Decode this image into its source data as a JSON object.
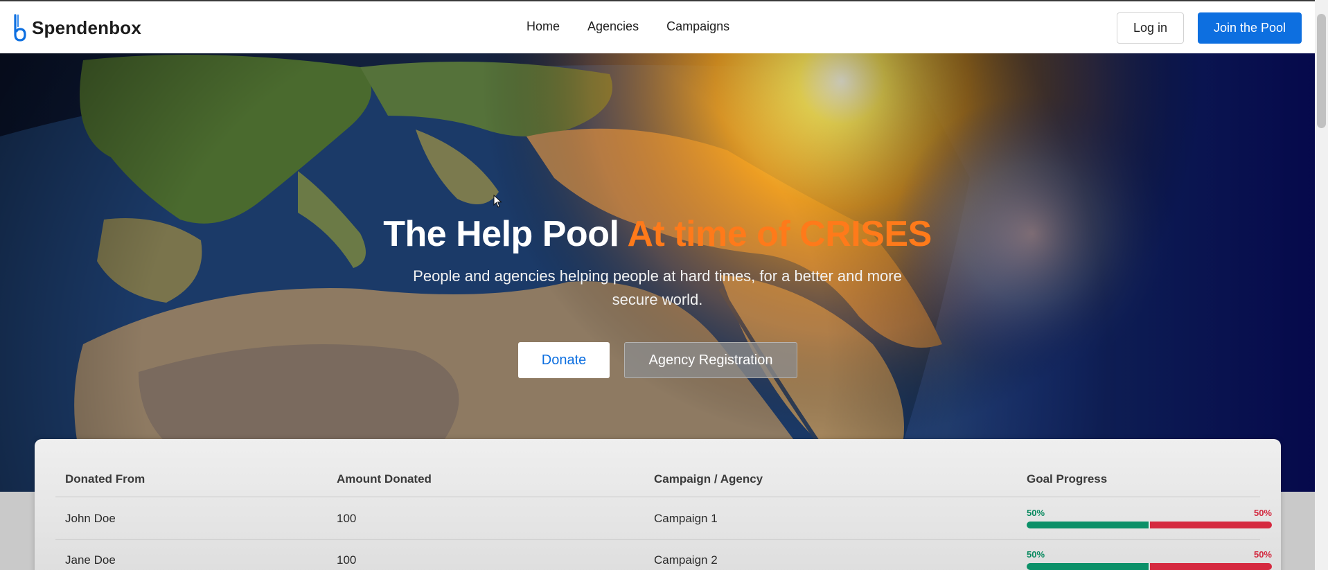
{
  "brand": {
    "name": "Spendenbox",
    "logo_icon": "spendenbox-logo-icon",
    "accent_color": "#0d6fe0"
  },
  "nav": {
    "links": [
      {
        "label": "Home"
      },
      {
        "label": "Agencies"
      },
      {
        "label": "Campaigns"
      }
    ],
    "login_label": "Log in",
    "join_label": "Join the Pool"
  },
  "hero": {
    "title_main": "The Help Pool",
    "title_accent": "At time of CRISES",
    "title_accent_color": "#ff7a1a",
    "subtitle": "People and agencies helping people at hard times, for a better and more secure world.",
    "donate_label": "Donate",
    "agency_registration_label": "Agency Registration"
  },
  "donations_table": {
    "headers": [
      "Donated From",
      "Amount Donated",
      "Campaign / Agency",
      "Goal Progress"
    ],
    "rows": [
      {
        "donor": "John Doe",
        "amount": "100",
        "campaign": "Campaign 1",
        "progress_done": 0.5,
        "progress_done_label": "50%",
        "progress_remaining_label": "50%"
      },
      {
        "donor": "Jane Doe",
        "amount": "100",
        "campaign": "Campaign 2",
        "progress_done": 0.5,
        "progress_done_label": "50%",
        "progress_remaining_label": "50%"
      }
    ],
    "progress_colors": {
      "done": "#0b9068",
      "remaining": "#d5293f"
    }
  }
}
